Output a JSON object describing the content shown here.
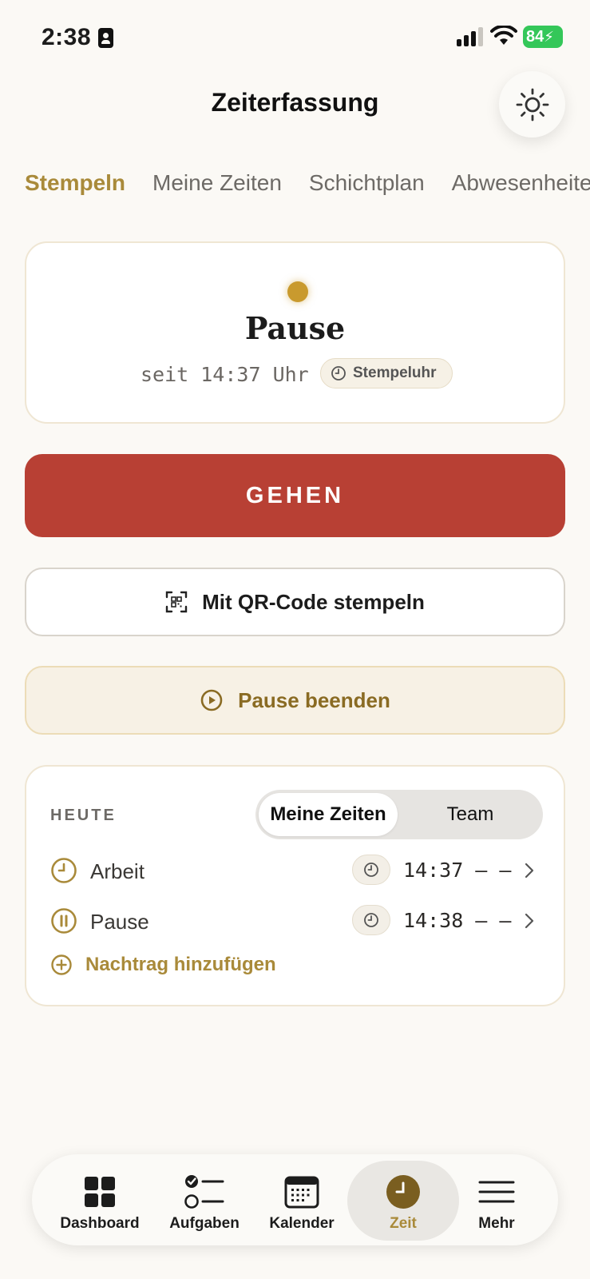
{
  "status_bar": {
    "time": "2:38",
    "battery": "84",
    "icons": [
      "id-card-icon",
      "cellular-signal-icon",
      "wifi-icon",
      "battery-charging-icon"
    ]
  },
  "header": {
    "title": "Zeiterfassung",
    "theme_icon": "sun-icon"
  },
  "tabs": [
    {
      "label": "Stempeln",
      "active": true
    },
    {
      "label": "Meine Zeiten",
      "active": false
    },
    {
      "label": "Schichtplan",
      "active": false
    },
    {
      "label": "Abwesenheiten",
      "active": false
    }
  ],
  "status_card": {
    "state": "Pause",
    "since": "seit 14:37 Uhr",
    "source_chip": "Stempeluhr",
    "dot_color": "#c99a2e"
  },
  "actions": {
    "primary": "GEHEN",
    "primary_color": "#b84034",
    "qr": "Mit QR-Code stempeln",
    "pause_end": "Pause beenden"
  },
  "today": {
    "label": "HEUTE",
    "segments": [
      {
        "label": "Meine Zeiten",
        "active": true
      },
      {
        "label": "Team",
        "active": false
      }
    ],
    "entries": [
      {
        "label": "Arbeit",
        "time": "14:37 – –",
        "icon": "clock-icon"
      },
      {
        "label": "Pause",
        "time": "14:38 – –",
        "icon": "pause-circle-icon"
      }
    ],
    "add_label": "Nachtrag hinzufügen"
  },
  "bottom_nav": [
    {
      "label": "Dashboard",
      "icon": "grid-icon",
      "active": false
    },
    {
      "label": "Aufgaben",
      "icon": "checklist-icon",
      "active": false
    },
    {
      "label": "Kalender",
      "icon": "calendar-icon",
      "active": false
    },
    {
      "label": "Zeit",
      "icon": "clock-icon",
      "active": true
    },
    {
      "label": "Mehr",
      "icon": "menu-icon",
      "active": false
    }
  ],
  "colors": {
    "accent": "#a98a3a",
    "background": "#fbf9f5"
  }
}
